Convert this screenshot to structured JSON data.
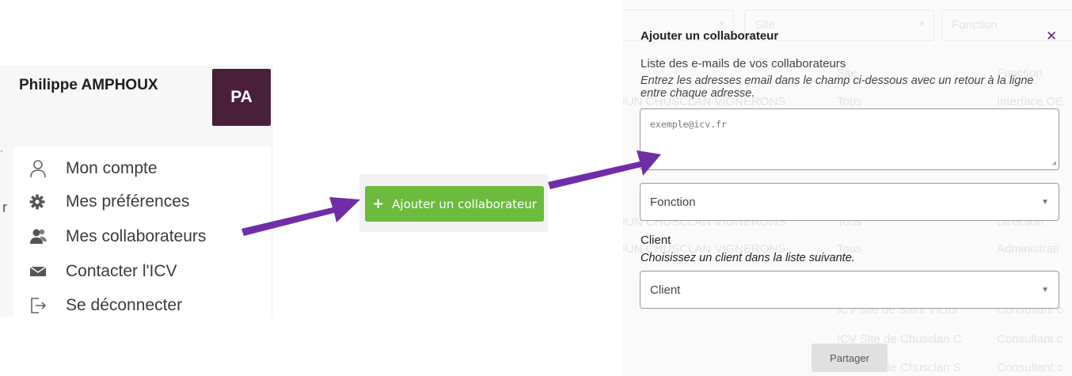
{
  "user_menu": {
    "name": "Philippe AMPHOUX",
    "initials": "PA",
    "items": [
      {
        "label": "Mon compte",
        "icon": "user-icon"
      },
      {
        "label": "Mes préférences",
        "icon": "gear-icon"
      },
      {
        "label": "Mes collaborateurs",
        "icon": "users-icon"
      },
      {
        "label": "Contacter l'ICV",
        "icon": "envelope-icon"
      },
      {
        "label": "Se déconnecter",
        "icon": "logout-icon"
      }
    ],
    "edge_fragment": "r"
  },
  "add_button": {
    "label": "Ajouter un collaborateur",
    "color": "#6cbb3c"
  },
  "arrow_color": "#6f2da8",
  "modal": {
    "title": "Ajouter un collaborateur",
    "emails_label": "Liste des e-mails de vos collaborateurs",
    "emails_hint": "Entrez les adresses email dans le champ ci-dessous avec un retour à la ligne entre chaque adresse.",
    "emails_placeholder": "exemple@icv.fr",
    "function_placeholder": "Fonction",
    "client_label": "Client",
    "client_hint": "Choisissez un client dans la liste suivante.",
    "client_placeholder": "Client",
    "share_label": "Partager",
    "accent_color": "#5b2a86"
  },
  "background_table": {
    "filters": [
      "Site",
      "Fonction"
    ],
    "headers": [
      "Site",
      "Fonction"
    ],
    "rows": [
      {
        "company": "DUN CHUSCLAN VIGNERONS",
        "site": "Tous",
        "function": "Interface OE"
      },
      {
        "company": "DUN CHUSCLAN VIGNERONS",
        "site": "Tous",
        "function": "Direction"
      },
      {
        "company": "DUN CHUSCLAN VIGNERONS",
        "site": "Tous",
        "function": "Administrati"
      },
      {
        "company": "",
        "site": "ICV site de Saint Victor",
        "function": "Consultant c"
      },
      {
        "company": "",
        "site": "ICV Site de Chusclan C",
        "function": "Consultant c"
      },
      {
        "company": "",
        "site": "ICV Site de Chusclan S",
        "function": "Consultant c"
      }
    ]
  }
}
